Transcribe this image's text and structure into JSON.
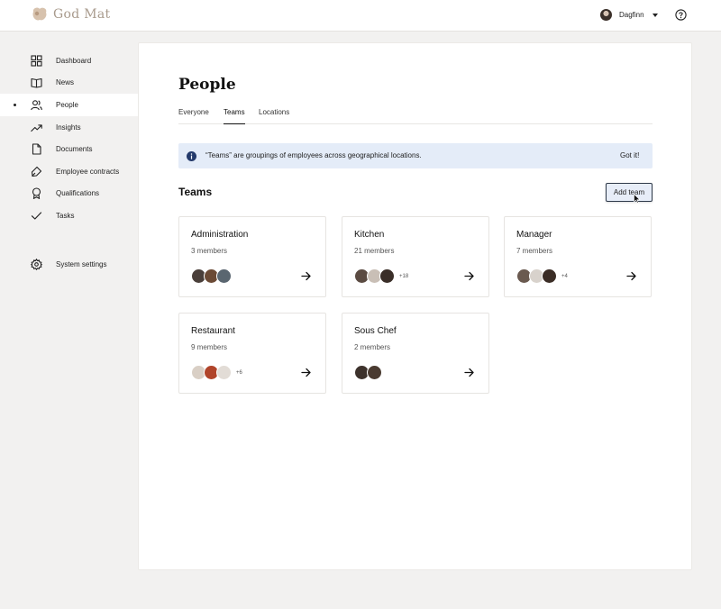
{
  "header": {
    "brand": "God Mat",
    "user_name": "Dagfinn"
  },
  "sidebar": {
    "items": [
      {
        "label": "Dashboard",
        "icon": "dashboard-icon"
      },
      {
        "label": "News",
        "icon": "book-icon"
      },
      {
        "label": "People",
        "icon": "people-icon",
        "active": true
      },
      {
        "label": "Insights",
        "icon": "trending-icon"
      },
      {
        "label": "Documents",
        "icon": "document-icon"
      },
      {
        "label": "Employee contracts",
        "icon": "pen-icon"
      },
      {
        "label": "Qualifications",
        "icon": "badge-icon"
      },
      {
        "label": "Tasks",
        "icon": "check-icon"
      }
    ],
    "settings_label": "System settings"
  },
  "page": {
    "title": "People",
    "tabs": [
      {
        "label": "Everyone"
      },
      {
        "label": "Teams",
        "active": true
      },
      {
        "label": "Locations"
      }
    ],
    "banner": {
      "text": "“Teams” are groupings of employees across geographical locations.",
      "action": "Got it!"
    },
    "section_title": "Teams",
    "add_button": "Add team"
  },
  "teams": [
    {
      "name": "Administration",
      "members": "3 members",
      "more": "",
      "avatar_colors": [
        "#4a3f3a",
        "#6b4a35",
        "#5a6670"
      ]
    },
    {
      "name": "Kitchen",
      "members": "21 members",
      "more": "+18",
      "avatar_colors": [
        "#5b4b42",
        "#c9bfb6",
        "#3a2e28"
      ]
    },
    {
      "name": "Manager",
      "members": "7 members",
      "more": "+4",
      "avatar_colors": [
        "#6a5a50",
        "#d8d2cc",
        "#3b2d26"
      ]
    },
    {
      "name": "Restaurant",
      "members": "9 members",
      "more": "+6",
      "avatar_colors": [
        "#d9cfc5",
        "#b0442a",
        "#e2dcd6"
      ]
    },
    {
      "name": "Sous Chef",
      "members": "2 members",
      "more": "",
      "avatar_colors": [
        "#3d322c",
        "#4a3b31"
      ]
    }
  ],
  "colors": {
    "background": "#f2f1f0",
    "banner": "#e4ecf8",
    "add_button": "#e7edf8",
    "logo": "#a89a8c"
  }
}
